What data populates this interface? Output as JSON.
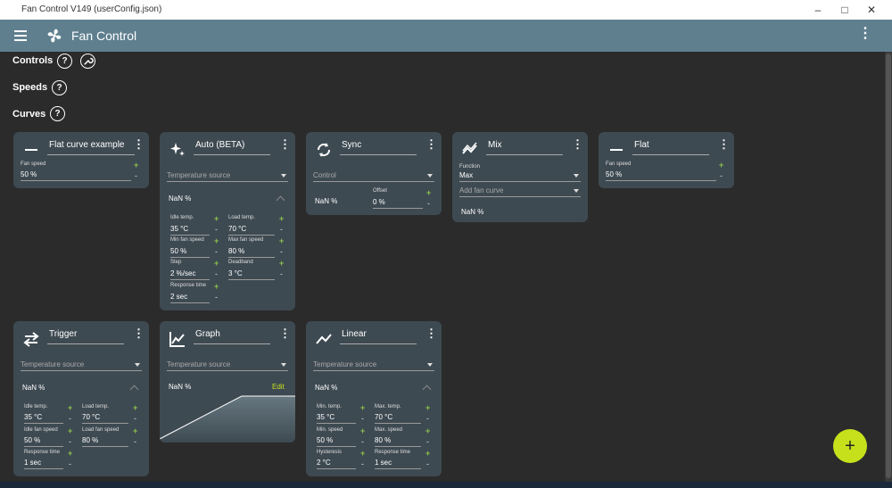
{
  "window_title": "Fan Control V149 (userConfig.json)",
  "app_title": "Fan Control",
  "colors": {
    "accent": "#c6e11b",
    "plus": "#8bc34a",
    "card": "#3e4a52",
    "appbar": "#5f7f8f"
  },
  "sections": {
    "controls": "Controls",
    "speeds": "Speeds",
    "curves": "Curves"
  },
  "cards": {
    "flat_example": {
      "name": "Flat curve example",
      "fan_speed_label": "Fan speed",
      "fan_speed": "50 %"
    },
    "auto": {
      "name": "Auto (BETA)",
      "source": "Temperature source",
      "nan": "NaN %",
      "idle_label": "Idle temp.",
      "idle": "35 °C",
      "load_label": "Load temp.",
      "load": "70 °C",
      "min_label": "Min fan speed",
      "min": "50 %",
      "max_label": "Max fan speed",
      "max": "80 %",
      "step_label": "Step",
      "step": "2 %/sec",
      "dead_label": "Deadband",
      "dead": "3 °C",
      "resp_label": "Response time",
      "resp": "2 sec"
    },
    "sync": {
      "name": "Sync",
      "control": "Control",
      "nan": "NaN %",
      "offset_label": "Offset",
      "offset": "0 %"
    },
    "mix": {
      "name": "Mix",
      "function_label": "Function",
      "function": "Max",
      "add": "Add fan curve",
      "nan": "NaN %"
    },
    "flat": {
      "name": "Flat",
      "fan_speed_label": "Fan speed",
      "fan_speed": "50 %"
    },
    "trigger": {
      "name": "Trigger",
      "source": "Temperature source",
      "nan": "NaN %",
      "idle_label": "Idle temp.",
      "idle": "35 °C",
      "load_label": "Load temp.",
      "load": "70 °C",
      "idle_fan_label": "Idle fan speed",
      "idle_fan": "50 %",
      "load_fan_label": "Load fan speed",
      "load_fan": "80 %",
      "resp_label": "Response time",
      "resp": "1 sec"
    },
    "graph": {
      "name": "Graph",
      "source": "Temperature source",
      "nan": "NaN %",
      "edit": "Edit"
    },
    "linear": {
      "name": "Linear",
      "source": "Temperature source",
      "nan": "NaN %",
      "min_t_label": "Min. temp.",
      "min_t": "35 °C",
      "max_t_label": "Max. temp.",
      "max_t": "70 °C",
      "min_s_label": "Min. speed",
      "min_s": "50 %",
      "max_s_label": "Max. speed",
      "max_s": "80 %",
      "hyst_label": "Hysteresis",
      "hyst": "2 °C",
      "resp_label": "Response time",
      "resp": "1 sec"
    }
  }
}
